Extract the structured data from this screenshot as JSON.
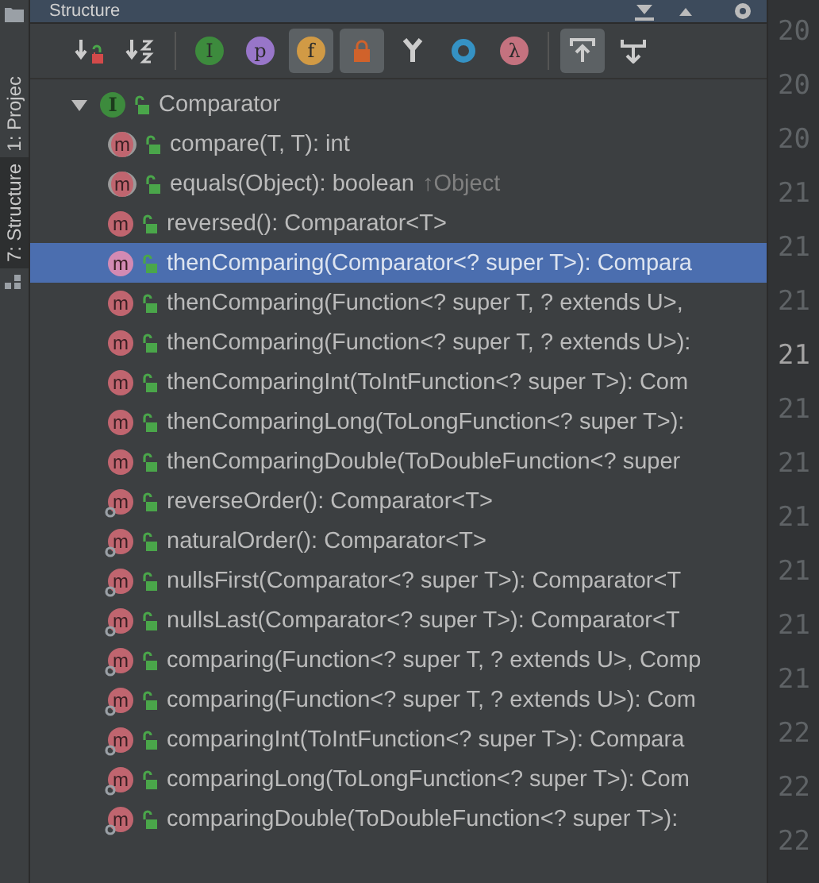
{
  "side_tabs": [
    {
      "label": "1: Projec",
      "selected": false
    },
    {
      "label": "7: Structure",
      "selected": true
    }
  ],
  "panel": {
    "title": "Structure"
  },
  "toolbar": [
    {
      "kind": "sort-visibility",
      "selected": false
    },
    {
      "kind": "sort-alpha",
      "selected": false
    },
    {
      "kind": "divider"
    },
    {
      "kind": "letter",
      "glyph": "I",
      "color": "#3d8b3d",
      "selected": false
    },
    {
      "kind": "letter",
      "glyph": "p",
      "color": "#9876c9",
      "selected": false
    },
    {
      "kind": "letter",
      "glyph": "f",
      "color": "#d19a45",
      "selected": true
    },
    {
      "kind": "lock",
      "selected": true
    },
    {
      "kind": "fork",
      "selected": false
    },
    {
      "kind": "ring",
      "selected": false
    },
    {
      "kind": "letter",
      "glyph": "λ",
      "color": "#c4727f",
      "selected": false
    },
    {
      "kind": "divider"
    },
    {
      "kind": "scroll-to",
      "selected": true
    },
    {
      "kind": "scroll-from",
      "selected": false
    }
  ],
  "tree": {
    "label": "Comparator",
    "icon_letter": "I",
    "expanded": true,
    "children": [
      {
        "kind": "abstract",
        "icon_letter": "m",
        "label": "compare(T, T): int",
        "selected": false
      },
      {
        "kind": "abstract",
        "icon_letter": "m",
        "label": "equals(Object): boolean",
        "inherited": "↑Object",
        "selected": false
      },
      {
        "kind": "method",
        "icon_letter": "m",
        "label": "reversed(): Comparator<T>",
        "selected": false
      },
      {
        "kind": "method",
        "icon_letter": "m",
        "label": "thenComparing(Comparator<? super T>): Compara",
        "selected": true
      },
      {
        "kind": "method",
        "icon_letter": "m",
        "label": "thenComparing(Function<? super T, ? extends U>,",
        "selected": false
      },
      {
        "kind": "method",
        "icon_letter": "m",
        "label": "thenComparing(Function<? super T, ? extends U>):",
        "selected": false
      },
      {
        "kind": "method",
        "icon_letter": "m",
        "label": "thenComparingInt(ToIntFunction<? super T>): Com",
        "selected": false
      },
      {
        "kind": "method",
        "icon_letter": "m",
        "label": "thenComparingLong(ToLongFunction<? super T>):",
        "selected": false
      },
      {
        "kind": "method",
        "icon_letter": "m",
        "label": "thenComparingDouble(ToDoubleFunction<? super",
        "selected": false
      },
      {
        "kind": "static",
        "icon_letter": "m",
        "label": "reverseOrder(): Comparator<T>",
        "selected": false
      },
      {
        "kind": "static",
        "icon_letter": "m",
        "label": "naturalOrder(): Comparator<T>",
        "selected": false
      },
      {
        "kind": "static",
        "icon_letter": "m",
        "label": "nullsFirst(Comparator<? super T>): Comparator<T",
        "selected": false
      },
      {
        "kind": "static",
        "icon_letter": "m",
        "label": "nullsLast(Comparator<? super T>): Comparator<T",
        "selected": false
      },
      {
        "kind": "static",
        "icon_letter": "m",
        "label": "comparing(Function<? super T, ? extends U>, Comp",
        "selected": false
      },
      {
        "kind": "static",
        "icon_letter": "m",
        "label": "comparing(Function<? super T, ? extends U>): Com",
        "selected": false
      },
      {
        "kind": "static",
        "icon_letter": "m",
        "label": "comparingInt(ToIntFunction<? super T>): Compara",
        "selected": false
      },
      {
        "kind": "static",
        "icon_letter": "m",
        "label": "comparingLong(ToLongFunction<? super T>): Com",
        "selected": false
      },
      {
        "kind": "static",
        "icon_letter": "m",
        "label": "comparingDouble(ToDoubleFunction<? super T>):",
        "selected": false
      }
    ]
  },
  "gutter": [
    {
      "text": "20",
      "current": false
    },
    {
      "text": "20",
      "current": false
    },
    {
      "text": "20",
      "current": false
    },
    {
      "text": "21",
      "current": false
    },
    {
      "text": "21",
      "current": false
    },
    {
      "text": "21",
      "current": false
    },
    {
      "text": "21",
      "current": true
    },
    {
      "text": "21",
      "current": false
    },
    {
      "text": "21",
      "current": false
    },
    {
      "text": "21",
      "current": false
    },
    {
      "text": "21",
      "current": false
    },
    {
      "text": "21",
      "current": false
    },
    {
      "text": "21",
      "current": false
    },
    {
      "text": "22",
      "current": false
    },
    {
      "text": "22",
      "current": false
    },
    {
      "text": "22",
      "current": false
    }
  ]
}
